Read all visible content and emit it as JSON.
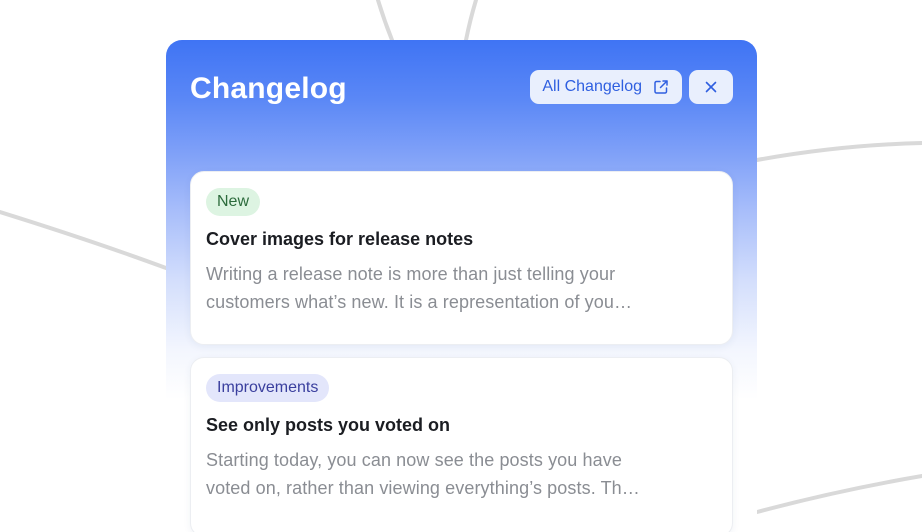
{
  "panel": {
    "title": "Changelog",
    "all_changelog_label": "All Changelog",
    "external_icon": "external-link-icon",
    "close_icon": "close-icon"
  },
  "entries": [
    {
      "badge": "New",
      "title": "Cover images for release notes",
      "description_line1": "Writing a release note is more than just telling your",
      "description_line2": "customers what’s new. It is a representation of you…"
    },
    {
      "badge": "Improvements",
      "title": "See only posts you voted on",
      "description_line1": "Starting today, you can now see the posts you have",
      "description_line2": "voted on, rather than viewing everything’s posts. Th…"
    }
  ],
  "colors": {
    "accent": "#3f74f4",
    "badge_new_bg": "#ddf4e2",
    "badge_new_text": "#2c6b3c",
    "badge_improvements_bg": "#e3e6fb",
    "badge_improvements_text": "#3a3f9e"
  }
}
